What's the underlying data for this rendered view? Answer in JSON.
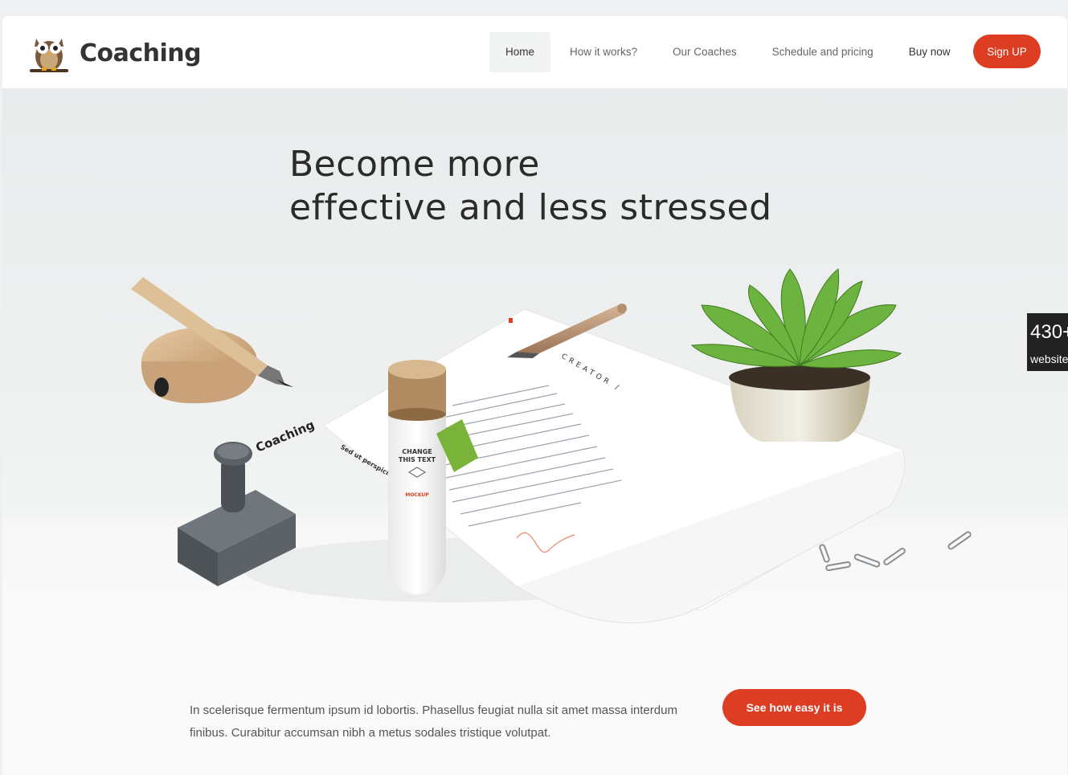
{
  "brand": {
    "name": "Coaching",
    "logo_icon": "owl-icon"
  },
  "nav": {
    "items": [
      {
        "label": "Home"
      },
      {
        "label": "How it works?"
      },
      {
        "label": "Our Coaches"
      },
      {
        "label": "Schedule and pricing"
      },
      {
        "label": "Buy now"
      }
    ],
    "signup_label": "Sign UP"
  },
  "hero": {
    "title_line1": "Become more",
    "title_line2": "effective and less stressed",
    "mockup": {
      "stamp_text": "Coaching",
      "tube_text_line1": "CHANGE",
      "tube_text_line2": "THIS TEXT",
      "tube_label": "MOCKUP",
      "paper_header": "CREATOR /",
      "paper_sub": "Sed ut perspiciatis"
    }
  },
  "cta": {
    "text": "In scelerisque fermentum ipsum id lobortis. Phasellus feugiat nulla sit amet massa interdum finibus. Curabitur accumsan nibh a metus sodales tristique volutpat.",
    "button_label": "See how easy it is"
  },
  "side_badge": {
    "number": "430+",
    "label": "websites"
  },
  "colors": {
    "accent": "#dd3d22",
    "text_dark": "#2b2b2b",
    "text_muted": "#666666"
  }
}
